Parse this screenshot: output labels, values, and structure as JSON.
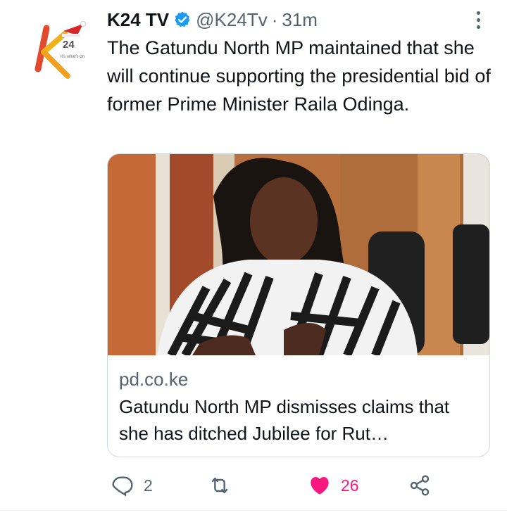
{
  "account": {
    "name": "K24 TV",
    "handle": "@K24Tv",
    "separator": "·",
    "time": "31m",
    "logo_letter": "K",
    "logo_number": "24",
    "logo_tagline": "it's what's on"
  },
  "tweet": {
    "text": "The Gatundu North MP maintained that she will continue supporting the presidential bid of former Prime Minister Raila Odinga."
  },
  "card": {
    "domain": "pd.co.ke",
    "title": "Gatundu North MP dismisses claims that she has ditched Jubilee for Rut…"
  },
  "actions": {
    "reply_count": "2",
    "retweet_count": "",
    "like_count": "26",
    "liked": true
  },
  "colors": {
    "verified": "#1d9bf0",
    "like": "#f91880",
    "muted": "#536471"
  }
}
